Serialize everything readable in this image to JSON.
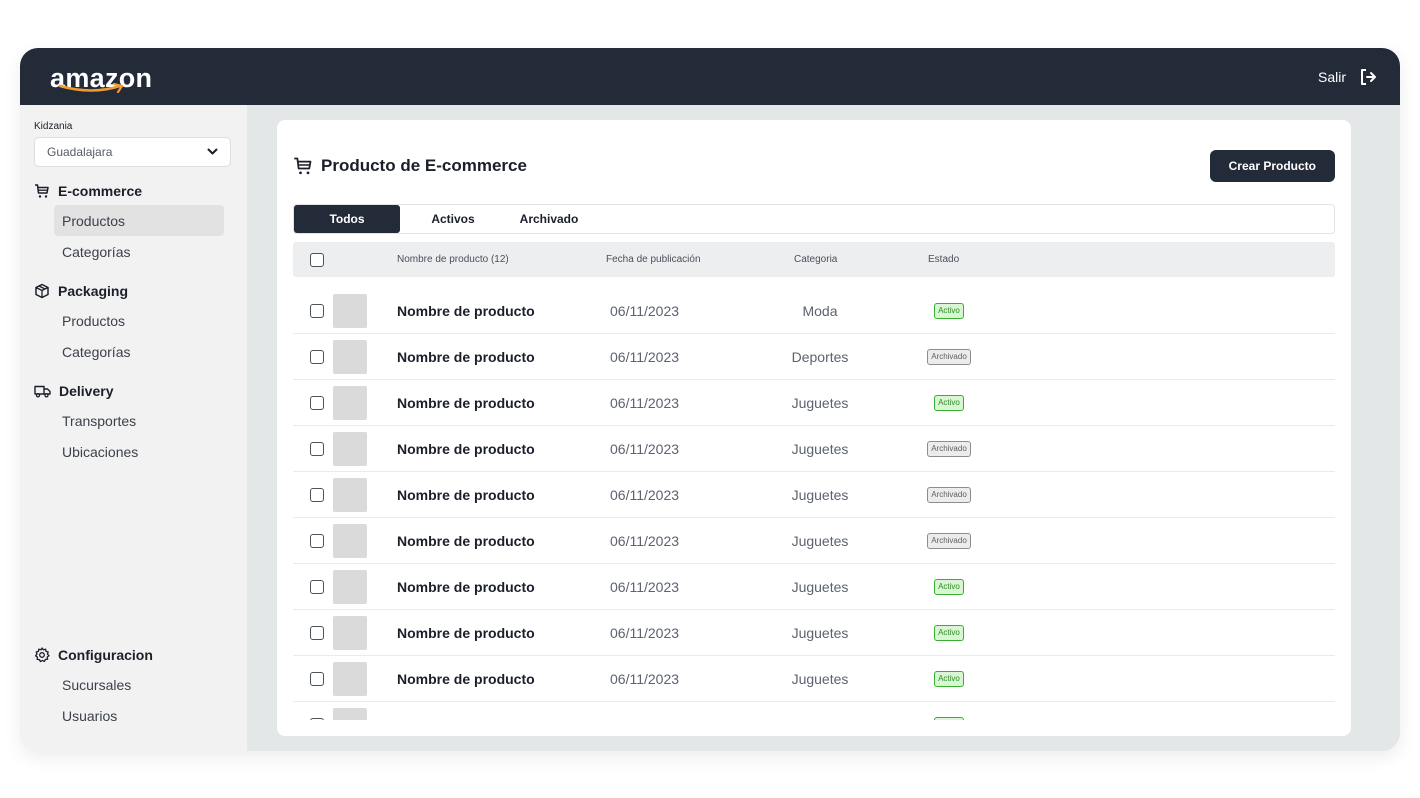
{
  "brand": {
    "logo_text": "amazon"
  },
  "topbar": {
    "logout_label": "Salir",
    "logout_icon": "logout-icon",
    "bg_color": "#232b38"
  },
  "sidebar": {
    "org_label": "Kidzania",
    "branch_select": {
      "value": "Guadalajara",
      "icon": "chevron-down-icon"
    },
    "sections": [
      {
        "title": "E-commerce",
        "icon": "cart-icon",
        "items": [
          {
            "label": "Productos",
            "active": true
          },
          {
            "label": "Categorías",
            "active": false
          }
        ]
      },
      {
        "title": "Packaging",
        "icon": "box-icon",
        "items": [
          {
            "label": "Productos",
            "active": false
          },
          {
            "label": "Categorías",
            "active": false
          }
        ]
      },
      {
        "title": "Delivery",
        "icon": "truck-icon",
        "items": [
          {
            "label": "Transportes",
            "active": false
          },
          {
            "label": "Ubicaciones",
            "active": false
          }
        ]
      }
    ],
    "config": {
      "title": "Configuracion",
      "icon": "gear-icon",
      "items": [
        {
          "label": "Sucursales"
        },
        {
          "label": "Usuarios"
        }
      ]
    }
  },
  "main": {
    "title": "Producto de E-commerce",
    "title_icon": "cart-icon",
    "create_button": "Crear Producto",
    "tabs": [
      {
        "label": "Todos",
        "active": true
      },
      {
        "label": "Activos",
        "active": false
      },
      {
        "label": "Archivado",
        "active": false
      }
    ],
    "table": {
      "columns": [
        "Nombre de producto (12)",
        "Fecha de publicación",
        "Categoria",
        "Estado"
      ],
      "rows": [
        {
          "name": "Nombre de producto",
          "date": "06/11/2023",
          "category": "Moda",
          "status": "Activo"
        },
        {
          "name": "Nombre de producto",
          "date": "06/11/2023",
          "category": "Deportes",
          "status": "Archivado"
        },
        {
          "name": "Nombre de producto",
          "date": "06/11/2023",
          "category": "Juguetes",
          "status": "Activo"
        },
        {
          "name": "Nombre de producto",
          "date": "06/11/2023",
          "category": "Juguetes",
          "status": "Archivado"
        },
        {
          "name": "Nombre de producto",
          "date": "06/11/2023",
          "category": "Juguetes",
          "status": "Archivado"
        },
        {
          "name": "Nombre de producto",
          "date": "06/11/2023",
          "category": "Juguetes",
          "status": "Archivado"
        },
        {
          "name": "Nombre de producto",
          "date": "06/11/2023",
          "category": "Juguetes",
          "status": "Activo"
        },
        {
          "name": "Nombre de producto",
          "date": "06/11/2023",
          "category": "Juguetes",
          "status": "Activo"
        },
        {
          "name": "Nombre de producto",
          "date": "06/11/2023",
          "category": "Juguetes",
          "status": "Activo"
        },
        {
          "name": "",
          "date": "",
          "category": "",
          "status": "Activo"
        }
      ]
    }
  },
  "colors": {
    "accent_dark": "#232b38",
    "active_badge": "#37b02f",
    "archived_badge": "#8d8d8d",
    "logo_smile": "#f29b2e"
  }
}
